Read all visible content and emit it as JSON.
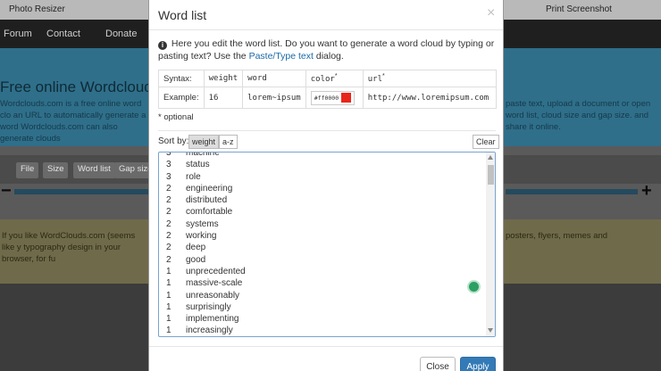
{
  "background": {
    "tab_left": "Photo Resizer",
    "tab_right": "Print Screenshot",
    "nav": [
      "Forum",
      "Contact",
      "Donate"
    ],
    "hero_title": "Free online Wordcloud gen",
    "hero_desc_left": "Wordclouds.com is a free online word clo an URL to automatically generate a word Wordclouds.com can also generate clouds",
    "hero_desc_right": "paste text, upload a document or open word list, cloud size and gap size. and share it online.",
    "toolbar": [
      "File",
      "Size",
      "Word list",
      "Gap size"
    ],
    "note_left": "If you like WordClouds.com (seems like y typography design in your browser, for fu",
    "note_right": "posters, flyers, memes and"
  },
  "modal": {
    "title": "Word list",
    "close_symbol": "×",
    "info_text": "Here you edit the word list. Do you want to generate a word cloud by typing or pasting text? Use the ",
    "info_link": "Paste/Type text",
    "info_suffix": " dialog.",
    "syntax": {
      "label": "Syntax:",
      "weight": "weight",
      "word": "word",
      "color": "color",
      "url": "url",
      "star": "*"
    },
    "example": {
      "label": "Example:",
      "weight": "16",
      "word": "lorem~ipsum",
      "color_hex": "#ff0000",
      "color_value": "#e8261a",
      "url": "http://www.loremipsum.com"
    },
    "optional_note": "* optional",
    "sort_label": "Sort by:",
    "sort_weight": "weight",
    "sort_az": "a-z",
    "clear_label": "Clear",
    "words": [
      {
        "w": "3",
        "t": "machine"
      },
      {
        "w": "3",
        "t": "status"
      },
      {
        "w": "3",
        "t": "role"
      },
      {
        "w": "2",
        "t": "engineering"
      },
      {
        "w": "2",
        "t": "distributed"
      },
      {
        "w": "2",
        "t": "comfortable"
      },
      {
        "w": "2",
        "t": "systems"
      },
      {
        "w": "2",
        "t": "working"
      },
      {
        "w": "2",
        "t": "deep"
      },
      {
        "w": "2",
        "t": "good"
      },
      {
        "w": "1",
        "t": "unprecedented"
      },
      {
        "w": "1",
        "t": "massive-scale"
      },
      {
        "w": "1",
        "t": "unreasonably"
      },
      {
        "w": "1",
        "t": "surprisingly"
      },
      {
        "w": "1",
        "t": "implementing"
      },
      {
        "w": "1",
        "t": "increasingly"
      }
    ],
    "close_button": "Close",
    "apply_button": "Apply"
  }
}
